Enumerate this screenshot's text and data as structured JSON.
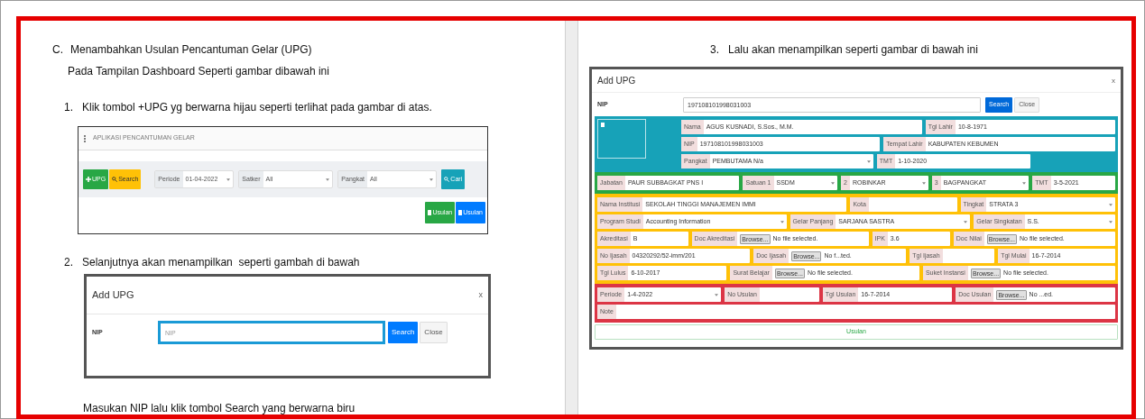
{
  "left": {
    "section": {
      "marker": "C.",
      "title": "Menambahkan Usulan Pencantuman Gelar (UPG)",
      "subtitle": "Pada Tampilan Dashboard Seperti gambar dibawah ini"
    },
    "step1": {
      "marker": "1.",
      "text": "Klik tombol +UPG yg berwarna hijau seperti terlihat pada gambar di atas."
    },
    "dashboard": {
      "title": "APLIKASI PENCANTUMAN GELAR",
      "add_button": "UPG",
      "search_button": "Search",
      "filters": [
        {
          "label": "Periode",
          "value": "01-04-2022"
        },
        {
          "label": "Satker",
          "value": "All"
        },
        {
          "label": "Pangkat",
          "value": "All"
        }
      ],
      "find_button": "Cari",
      "action_buttons": [
        {
          "label": "Usulan",
          "color": "#28a745"
        },
        {
          "label": "Usulan",
          "color": "#007bff"
        }
      ]
    },
    "step2": {
      "marker": "2.",
      "text": "Selanjutnya akan menampilkan  seperti gambah di bawah"
    },
    "modal": {
      "title": "Add UPG",
      "close": "x",
      "nip_label": "NIP",
      "placeholder": "NIP",
      "search_button": "Search",
      "close_button": "Close"
    },
    "caption": "Masukan NIP lalu klik tombol Search yang berwarna biru"
  },
  "right": {
    "step3": {
      "marker": "3.",
      "text": "Lalu akan menampilkan seperti gambar di bawah ini"
    },
    "modal": {
      "title": "Add UPG",
      "close": "x",
      "nip_label": "NIP",
      "nip_value": "197108101998031003",
      "search_button": "Search",
      "close_button": "Close",
      "sections": [
        {
          "kind": "profile",
          "color": "#17a2b8",
          "rows": [
            [
              {
                "label": "Nama",
                "value": "AGUS KUSNADI, S.Sos., M.M.",
                "kind": "text"
              },
              {
                "label": "Tgl Lahir",
                "value": "10-8-1971",
                "kind": "text"
              }
            ],
            [
              {
                "label": "NIP",
                "value": "197108101998031003",
                "kind": "text"
              },
              {
                "label": "Tempat Lahir",
                "value": "KABUPATEN KEBUMEN",
                "kind": "text"
              }
            ],
            [
              {
                "label": "Pangkat",
                "value": "PEMBUTAMA N/a",
                "kind": "select"
              },
              {
                "label": "TMT",
                "value": "1-10-2020",
                "kind": "text"
              }
            ]
          ]
        },
        {
          "kind": "plain",
          "color": "#28a745",
          "rows": [
            [
              {
                "label": "Jabatan",
                "value": "PAUR SUBBAGKAT PNS I",
                "kind": "text"
              },
              {
                "label": "Satuan 1",
                "value": "SSDM",
                "kind": "select"
              },
              {
                "label": "2",
                "value": "ROBINKAR",
                "kind": "select"
              },
              {
                "label": "3",
                "value": "BAGPANGKAT",
                "kind": "select"
              },
              {
                "label": "TMT",
                "value": "3-5-2021",
                "kind": "text"
              }
            ]
          ]
        },
        {
          "kind": "plain",
          "color": "#ffc107",
          "rows": [
            [
              {
                "label": "Nama Institusi",
                "value": "SEKOLAH TINGGI MANAJEMEN IMMI",
                "kind": "text"
              },
              {
                "label": "Kota",
                "kind": "text"
              },
              {
                "label": "Tingkat",
                "value": "STRATA 3",
                "kind": "select"
              }
            ],
            [
              {
                "label": "Program Studi",
                "value": "Accounting Information",
                "kind": "select"
              },
              {
                "label": "Gelar Panjang",
                "value": "SARJANA SASTRA",
                "kind": "select"
              },
              {
                "label": "Gelar Singkatan",
                "value": "S.S.",
                "kind": "select"
              }
            ],
            [
              {
                "label": "Akreditasi",
                "value": "B",
                "kind": "text"
              },
              {
                "label": "Doc Akreditasi",
                "button": "Browse...",
                "value": "No file selected.",
                "kind": "file"
              },
              {
                "label": "IPK",
                "value": "3.6",
                "kind": "text"
              },
              {
                "label": "Doc Nilai",
                "button": "Browse...",
                "value": "No file selected.",
                "kind": "file"
              }
            ],
            [
              {
                "label": "No Ijasah",
                "value": "04320292/52-imm/201",
                "kind": "text"
              },
              {
                "label": "Doc Ijasah",
                "button": "Browse...",
                "value": "No f...ted.",
                "kind": "file"
              },
              {
                "label": "Tgl Ijasah",
                "kind": "text"
              },
              {
                "label": "Tgl Mulai",
                "value": "16-7-2014",
                "kind": "text"
              }
            ],
            [
              {
                "label": "Tgl Lulus",
                "value": "6-10-2017",
                "kind": "text"
              },
              {
                "label": "Surat Belajar",
                "button": "Browse...",
                "value": "No file selected.",
                "kind": "file"
              },
              {
                "label": "Suket Instansi",
                "button": "Browse...",
                "value": "No file selected.",
                "kind": "file"
              }
            ]
          ]
        },
        {
          "kind": "plain",
          "color": "#dc3545",
          "rows": [
            [
              {
                "label": "Periode",
                "value": "1-4-2022",
                "kind": "select"
              },
              {
                "label": "No Usulan",
                "kind": "text"
              },
              {
                "label": "Tgl Usulan",
                "value": "16-7-2014",
                "kind": "text"
              },
              {
                "label": "Doc Usulan",
                "button": "Browse...",
                "value": "No ...ed.",
                "kind": "file"
              }
            ],
            [
              {
                "label": "Note",
                "kind": "text"
              }
            ]
          ]
        }
      ],
      "submit_button": "Usulan"
    }
  }
}
